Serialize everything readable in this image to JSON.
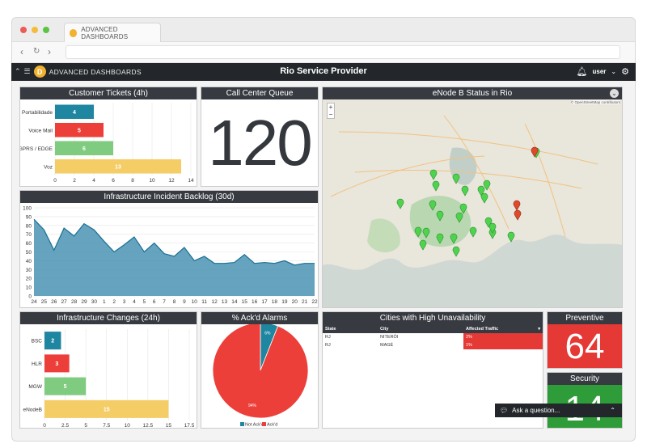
{
  "browser": {
    "tab_title": "ADVANCED DASHBOARDS"
  },
  "header": {
    "brand": "ADVANCED DASHBOARDS",
    "title": "Rio Service Provider",
    "user": "user"
  },
  "customer_tickets": {
    "title": "Customer Tickets (4h)",
    "chart_data": {
      "type": "bar",
      "categories": [
        "Portabilidade",
        "Voice Mail",
        "GPRS / EDGE",
        "Voz"
      ],
      "values": [
        4,
        5,
        6,
        13
      ],
      "colors": [
        "#1e86a0",
        "#ec3f3a",
        "#7fcb7f",
        "#f4cd67"
      ],
      "xticks": [
        "0",
        "2",
        "4",
        "6",
        "8",
        "10",
        "12",
        "14"
      ],
      "xlim": [
        0,
        14
      ]
    }
  },
  "call_center": {
    "title": "Call Center Queue",
    "value": "120"
  },
  "map": {
    "title": "eNode B Status in Rio",
    "attribution": "© OpenStreetMap contributors"
  },
  "backlog": {
    "title": "Infrastructure Incident Backlog (30d)",
    "chart_data": {
      "type": "area",
      "x": [
        "24",
        "25",
        "26",
        "27",
        "28",
        "29",
        "30",
        "1",
        "2",
        "3",
        "4",
        "5",
        "6",
        "7",
        "8",
        "9",
        "10",
        "11",
        "12",
        "13",
        "14",
        "15",
        "16",
        "17",
        "18",
        "19",
        "20",
        "21",
        "22"
      ],
      "values": [
        87,
        75,
        52,
        77,
        68,
        82,
        75,
        62,
        50,
        58,
        67,
        50,
        60,
        48,
        45,
        55,
        40,
        45,
        37,
        37,
        38,
        47,
        37,
        38,
        37,
        40,
        35,
        37,
        37
      ],
      "ylim": [
        0,
        100
      ],
      "yticks": [
        "0",
        "10",
        "20",
        "30",
        "40",
        "50",
        "60",
        "70",
        "80",
        "90",
        "100"
      ],
      "color": "#4a93b4"
    }
  },
  "infra_changes": {
    "title": "Infrastructure Changes (24h)",
    "chart_data": {
      "type": "bar",
      "categories": [
        "BSC",
        "HLR",
        "MGW",
        "eNodeB"
      ],
      "values": [
        2,
        3,
        5,
        15
      ],
      "colors": [
        "#1e86a0",
        "#ec3f3a",
        "#7fcb7f",
        "#f4cd67"
      ],
      "xticks": [
        "0",
        "2.5",
        "5",
        "7.5",
        "10",
        "12.5",
        "15",
        "17.5"
      ],
      "xlim": [
        0,
        17.5
      ]
    }
  },
  "alarms": {
    "title": "% Ack'd Alarms",
    "chart_data": {
      "type": "pie",
      "labels": [
        "Not Ack'd",
        "Ack'd"
      ],
      "values": [
        6,
        94
      ],
      "value_labels": [
        "6%",
        "94%"
      ],
      "colors": [
        "#1e86a0",
        "#ec3f3a"
      ]
    }
  },
  "cities": {
    "title": "Cities with High Unavailability",
    "columns": [
      "State",
      "City",
      "Affected Traffic"
    ],
    "rows": [
      {
        "state": "RJ",
        "city": "NITERÓI",
        "traffic": "2%"
      },
      {
        "state": "RJ",
        "city": "MAGÉ",
        "traffic": "1%"
      }
    ]
  },
  "preventive": {
    "title": "Preventive",
    "value": "64",
    "color": "#e53935"
  },
  "security": {
    "title": "Security",
    "value": "14",
    "color": "#2e9c38"
  },
  "ask": {
    "label": "Ask a question..."
  }
}
